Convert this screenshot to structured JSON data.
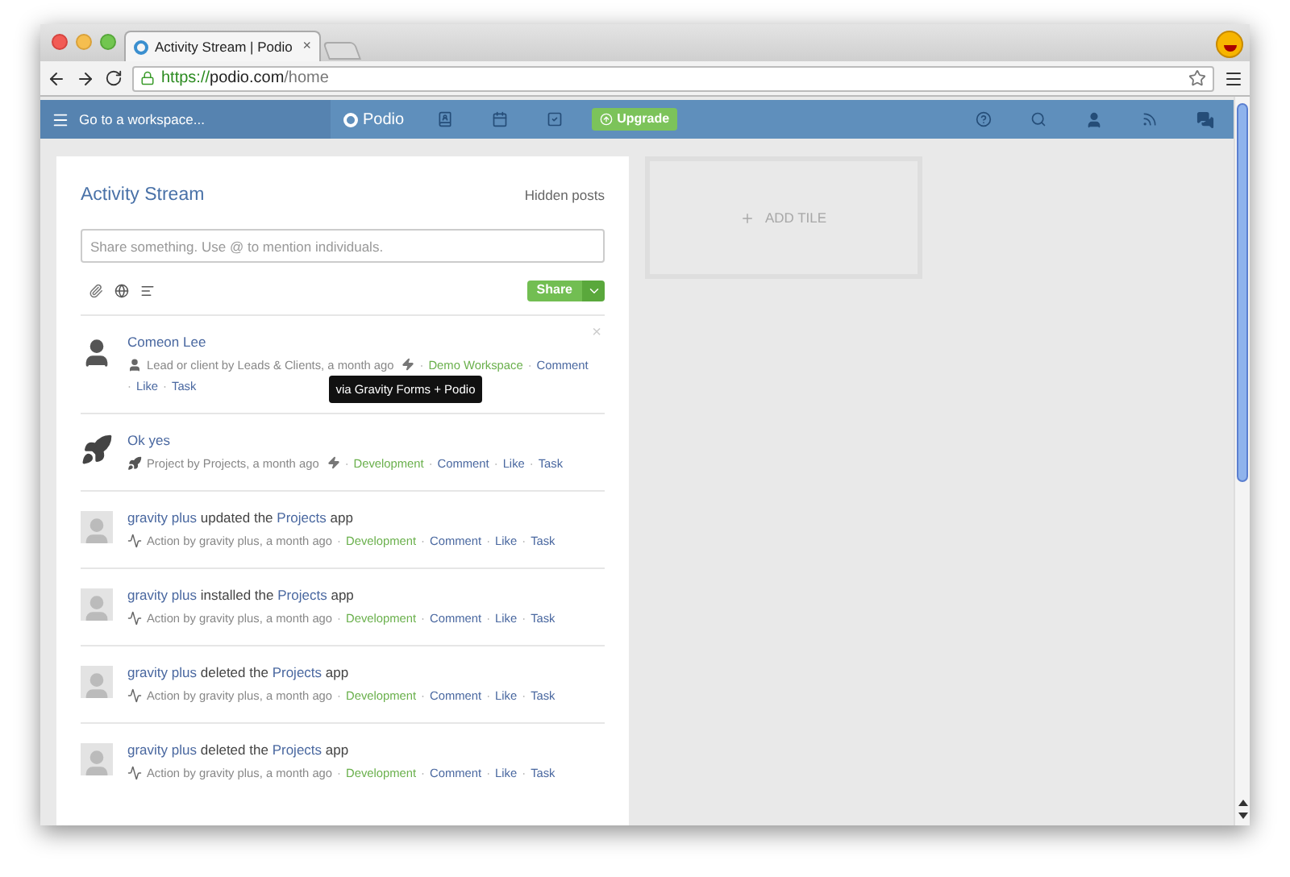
{
  "browser": {
    "tab": {
      "title": "Activity Stream | Podio",
      "close": "×"
    },
    "address": {
      "scheme": "https://",
      "host": "podio.com",
      "path": "/home"
    }
  },
  "nav": {
    "workspace": "Go to a workspace...",
    "brand": "Podio",
    "upgrade": "Upgrade"
  },
  "stream": {
    "title": "Activity Stream",
    "hidden": "Hidden posts",
    "placeholder": "Share something. Use @ to mention individuals.",
    "share": "Share",
    "separator": "·",
    "items": [
      {
        "kind": "lead",
        "close": "×",
        "title": "Comeon Lee",
        "meta": "Lead or client by Leads & Clients, a month ago",
        "tooltip": "via Gravity Forms + Podio",
        "workspace": "Demo Workspace",
        "actions": [
          "Comment",
          "Like",
          "Task"
        ]
      },
      {
        "kind": "project",
        "title": "Ok yes",
        "meta": "Project by Projects, a month ago",
        "workspace": "Development",
        "actions": [
          "Comment",
          "Like",
          "Task"
        ]
      },
      {
        "kind": "action",
        "actor": "gravity plus",
        "verb": "updated the",
        "app": "Projects",
        "suffix": "app",
        "meta": "Action by gravity plus, a month ago",
        "workspace": "Development",
        "actions": [
          "Comment",
          "Like",
          "Task"
        ]
      },
      {
        "kind": "action",
        "actor": "gravity plus",
        "verb": "installed the",
        "app": "Projects",
        "suffix": "app",
        "meta": "Action by gravity plus, a month ago",
        "workspace": "Development",
        "actions": [
          "Comment",
          "Like",
          "Task"
        ]
      },
      {
        "kind": "action",
        "actor": "gravity plus",
        "verb": "deleted the",
        "app": "Projects",
        "suffix": "app",
        "meta": "Action by gravity plus, a month ago",
        "workspace": "Development",
        "actions": [
          "Comment",
          "Like",
          "Task"
        ]
      },
      {
        "kind": "action",
        "actor": "gravity plus",
        "verb": "deleted the",
        "app": "Projects",
        "suffix": "app",
        "meta": "Action by gravity plus, a month ago",
        "workspace": "Development",
        "actions": [
          "Comment",
          "Like",
          "Task"
        ]
      }
    ]
  },
  "tile": {
    "label": "ADD TILE"
  }
}
